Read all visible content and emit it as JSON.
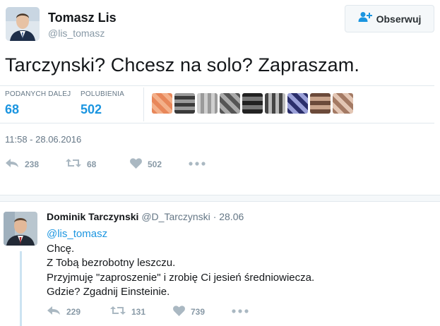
{
  "tweet": {
    "author_name": "Tomasz Lis",
    "author_handle": "@lis_tomasz",
    "follow_label": "Obserwuj",
    "text": "Tarczynski? Chcesz na solo? Zapraszam.",
    "stats": {
      "retweets_label": "PODANYCH DALEJ",
      "retweets_value": "68",
      "likes_label": "POLUBIENIA",
      "likes_value": "502"
    },
    "timestamp": "11:58 - 28.06.2016",
    "actions": {
      "reply_count": "238",
      "retweet_count": "68",
      "like_count": "502"
    }
  },
  "reply": {
    "author_name": "Dominik Tarczynski",
    "author_handle": "@D_Tarczynski",
    "date": "· 28.06",
    "mention": "@lis_tomasz",
    "lines": [
      "Chcę.",
      "Z Tobą bezrobotny leszczu.",
      "Przyjmuję \"zaproszenie\" i zrobię Ci jesień średniowiecza.",
      "Gdzie? Zgadnij Einsteinie."
    ],
    "actions": {
      "reply_count": "229",
      "retweet_count": "131",
      "like_count": "739"
    }
  },
  "icons": {
    "follow": "person-plus-icon",
    "reply": "reply-arrow-icon",
    "retweet": "retweet-icon",
    "like": "heart-icon",
    "more": "more-dots-icon"
  },
  "colors": {
    "link_blue": "#1b95e0",
    "muted_gray": "#8899a6",
    "thread_line": "#cce3f2"
  }
}
